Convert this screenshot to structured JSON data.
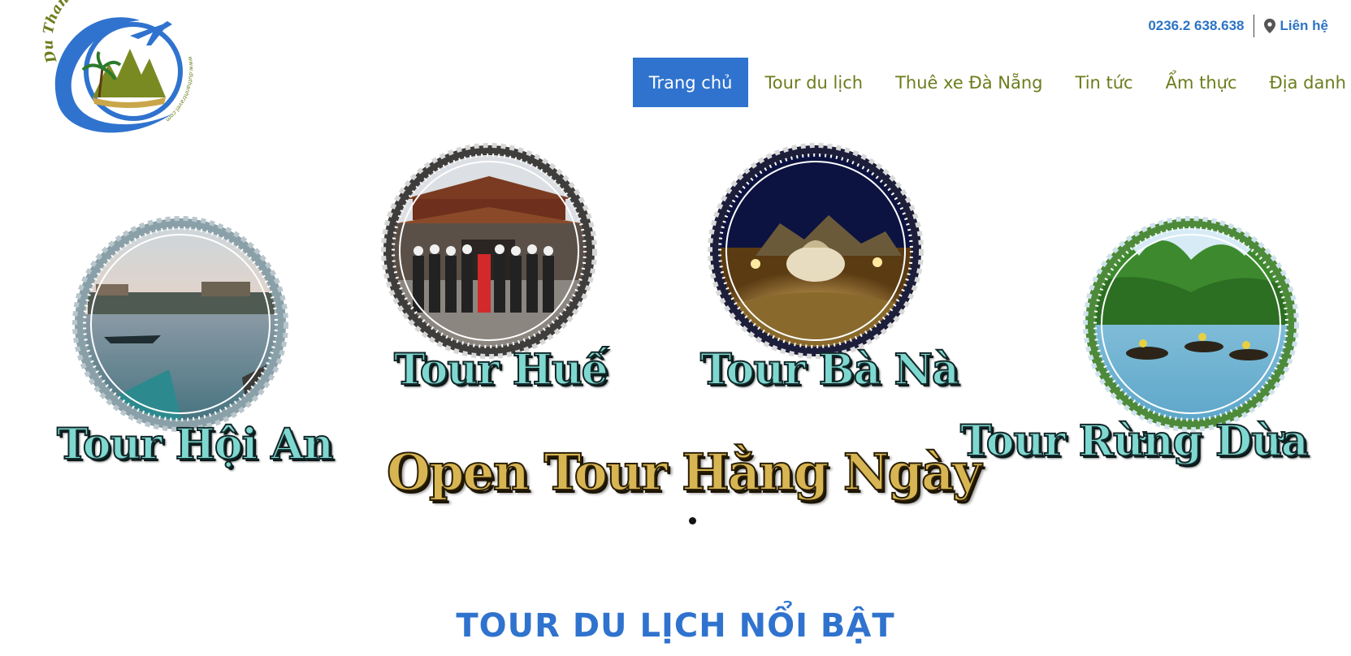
{
  "logo": {
    "brand_text": "Du Thanh Travel",
    "url_text": "www.duthanhtravel.com",
    "colors": {
      "blue": "#2f73ce",
      "olive": "#7a8a22",
      "gold": "#c9a64a"
    }
  },
  "topbar": {
    "phone": "0236.2 638.638",
    "contact_label": "Liên hệ",
    "contact_icon": "map-pin-icon"
  },
  "nav": {
    "items": [
      {
        "label": "Trang chủ",
        "active": true
      },
      {
        "label": "Tour du lịch",
        "active": false
      },
      {
        "label": "Thuê xe Đà Nẵng",
        "active": false
      },
      {
        "label": "Tin tức",
        "active": false
      },
      {
        "label": "Ẩm thực",
        "active": false
      },
      {
        "label": "Địa danh",
        "active": false
      }
    ],
    "active_color": "#2f73ce",
    "text_color": "#6b7d1c"
  },
  "slider": {
    "tours": [
      {
        "label": "Tour Hội An",
        "photo": "hoi-an-river-boats"
      },
      {
        "label": "Tour Huế",
        "photo": "hue-citadel-group"
      },
      {
        "label": "Tour Bà Nà",
        "photo": "ba-na-night-castle"
      },
      {
        "label": "Tour Rừng Dừa",
        "photo": "coconut-forest-basket-boats"
      }
    ],
    "headline": "Open Tour Hằng Ngày",
    "slide_count": 1,
    "active_slide": 1
  },
  "section": {
    "title": "TOUR DU LỊCH NỔI BẬT"
  }
}
